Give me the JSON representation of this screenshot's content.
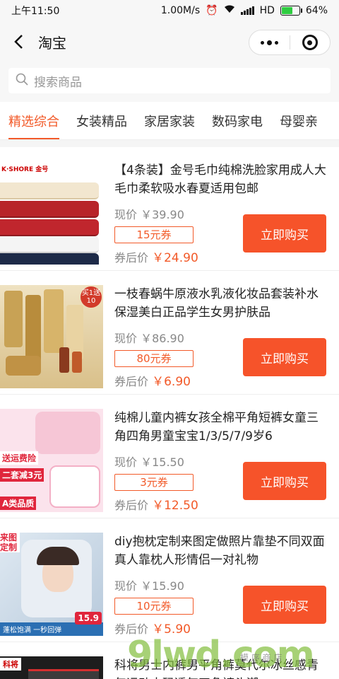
{
  "status_bar": {
    "time": "上午11:50",
    "speed": "1.00M/s",
    "network": "HD",
    "battery": "64%",
    "battery_level": 0.64
  },
  "title_bar": {
    "title": "淘宝"
  },
  "search": {
    "placeholder": "搜索商品"
  },
  "tabs": [
    {
      "label": "精选综合",
      "active": true
    },
    {
      "label": "女装精品"
    },
    {
      "label": "家居家装"
    },
    {
      "label": "数码家电"
    },
    {
      "label": "母婴亲"
    }
  ],
  "products": [
    {
      "title": "【4条装】金号毛巾纯棉洗脸家用成人大毛巾柔软吸水春夏适用包邮",
      "current_price": "现价 ￥39.90",
      "coupon": "15元券",
      "after_label": "券后价",
      "after_price": "￥24.90",
      "buy_label": "立即购买",
      "thumb_brand": "K·SHORE 金号"
    },
    {
      "title": "一枝春蜗牛原液水乳液化妆品套装补水保湿美白正品学生女男护肤品",
      "current_price": "现价 ￥86.90",
      "coupon": "80元券",
      "after_label": "券后价",
      "after_price": "￥6.90",
      "buy_label": "立即购买",
      "thumb_badge": "买1送10"
    },
    {
      "title": "纯棉儿童内裤女孩全棉平角短裤女童三角四角男童宝宝1/3/5/7/9岁6",
      "current_price": "现价 ￥15.50",
      "coupon": "3元券",
      "after_label": "券后价",
      "after_price": "￥12.50",
      "buy_label": "立即购买",
      "thumb_text_1": "送运费险",
      "thumb_text_2": "二套减3元",
      "thumb_text_3": "A类品质"
    },
    {
      "title": "diy抱枕定制来图定做照片靠垫不同双面真人靠枕人形情侣一对礼物",
      "current_price": "现价 ￥15.90",
      "coupon": "10元券",
      "after_label": "券后价",
      "after_price": "￥5.90",
      "buy_label": "立即购买",
      "thumb_text_1": "来图定制",
      "thumb_text_2": "蓬松饱满 一秒回弹",
      "thumb_badge": "15.9"
    },
    {
      "title": "科将男士内裤男平角裤莫代尔冰丝感青年运动大码透气四角裤头潮",
      "thumb_brand": "科将"
    }
  ],
  "watermark": {
    "text": "9lwd.com",
    "small": "模 序 商 店"
  }
}
